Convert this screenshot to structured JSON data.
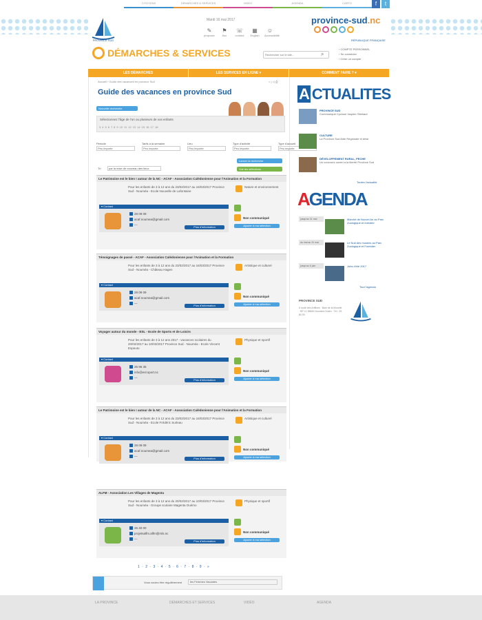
{
  "topnav": [
    "CITOYENS",
    "DEMARCHES & SERVICES",
    "VIDEO",
    "AGENDA",
    "CARTO"
  ],
  "social": {
    "facebook": "f",
    "twitter": "t"
  },
  "logo_label": "PROVINCE SUD",
  "header": {
    "date": "Mardi 16 mai 2017",
    "tools": [
      {
        "icon": "pencil-icon",
        "glyph": "✎",
        "label": "proposer"
      },
      {
        "icon": "bookmark-icon",
        "glyph": "⚑",
        "label": "flux"
      },
      {
        "icon": "contact-icon",
        "glyph": "☏",
        "label": "contact"
      },
      {
        "icon": "grid-icon",
        "glyph": "▦",
        "label": "English"
      },
      {
        "icon": "accessibility-icon",
        "glyph": "☺",
        "label": "Accessibilité"
      }
    ],
    "brand": "province-sud",
    "brand_suffix": ".nc",
    "brand_sub": "RÉPUBLIQUE FRANÇAISE"
  },
  "main_title": "DÉMARCHES & SERVICES",
  "search": {
    "placeholder": "Rechercher sur le site..."
  },
  "account": [
    "› COMPTE PERSONNEL",
    "› Se connecter",
    "› Créer un compte"
  ],
  "navbar": [
    "LES DÉMARCHES",
    "LES SERVICES EN LIGNE ▾",
    "COMMENT FAIRE ? ▾"
  ],
  "breadcrumb": "Accueil › Guide des vacances en province Sud",
  "pager_top": "< | >| ⎙",
  "page_title": "Guide des vacances en province Sud",
  "new_search": "Nouvelle recherche",
  "filter_intro": "Sélectionnez l'âge de l'un ou plusieurs de vos enfants",
  "ages": [
    "3",
    "4",
    "5",
    "6",
    "7",
    "8",
    "9",
    "10",
    "11",
    "12",
    "13",
    "14",
    "15",
    "16",
    "17",
    "18"
  ],
  "filters": [
    {
      "label": "Période",
      "value": "Peu importe"
    },
    {
      "label": "Tarifs à la semaine",
      "value": "Peu importe"
    },
    {
      "label": "Lieu",
      "value": "Peu importe"
    },
    {
      "label": "Type d'activité",
      "value": "Peu importe"
    },
    {
      "label": "Type d'accueil",
      "value": "Peu importe"
    }
  ],
  "sort": {
    "label": "Tri",
    "value": "par la mise de nouveau des lieux"
  },
  "btn_launch": "Lancer la recherche",
  "btn_all": "Voir les sélections",
  "cards": [
    {
      "title": "Le Patrimoine est le bien ! autour de la NC - ACAF - Association Calédonienne pour l'Animation et la Formation",
      "desc": "Pour les enfants de 3 à 12 ans du 23/02/2017 au 16/03/2017 Province Sud - Nouméa - Ecole Nouvelle de Lafontaine",
      "cat": "Nature et environnement",
      "phone": "28 09 09",
      "email": "acaf.noumea@gmail.com",
      "more": "Plus d'information",
      "label": "Non communiqué",
      "sel": "Ajouter à ma sélection"
    },
    {
      "title": "Témoignages de passé - ACAF - Association Calédonienne pour l'Animation et la Formation",
      "desc": "Pour les enfants de 3 à 12 ans du 23/02/2017 au 16/03/2017 Province Sud - Nouméa - Château Hagen",
      "cat": "Artistique et culturel",
      "phone": "28 09 09",
      "email": "acaf.noumea@gmail.com",
      "more": "Plus d'information",
      "label": "Non communiqué",
      "sel": "Ajouter à ma sélection"
    },
    {
      "title": "Voyager autour du monde - ESL - Ecole de Sports et de Loisirs",
      "desc": "Pour les enfants de 3 à 12 ans 2017 - vacances scolaires du 20/02/2017 au 10/03/2017 Province Sud - Nouméa - Ecole Vincent Espeuto",
      "cat": "Physique et sportif",
      "phone": "26 96 35",
      "email": "info@esl.sport.nc",
      "more": "Plus d'information",
      "label": "Non communiqué",
      "sel": "Ajouter à ma sélection"
    },
    {
      "title": "Le Patrimoine est le bien ! autour de la NC - ACAF - Association Calédonienne pour l'Animation et la Formation",
      "desc": "Pour les enfants de 3 à 12 ans du 23/02/2017 au 16/03/2017 Province Sud - Nouméa - Ecole Frédéric Surleau",
      "cat": "Artistique et culturel",
      "phone": "28 09 09",
      "email": "acaf.noumea@gmail.com",
      "more": "Plus d'information",
      "label": "Non communiqué",
      "sel": "Ajouter à ma sélection"
    },
    {
      "title": "ALFM - Association Les Villages de Magenta",
      "desc": "Pour les enfants de 3 à 12 ans du 20/02/2017 au 10/03/2017 Province Sud - Nouméa - Groupe scolaire Magenta Ouémo",
      "cat": "Physique et sportif",
      "phone": "26 40 00",
      "email": "projetsalfm.alfm@mls.nc",
      "more": "Plus d'information",
      "label": "Non communiqué",
      "sel": "Ajouter à ma sélection"
    }
  ],
  "pagination": "1 · 2 · 3 · 4 · 5 · 6 · 7 · 8 · 9 · »",
  "bottom": {
    "label": "Vous voulez être régulièrement",
    "value": "les Femmes Vacantes"
  },
  "news": {
    "title_a": "A",
    "title_b": "CTUALITES",
    "items": [
      {
        "head": "PROVINCE SUD",
        "text": "Communiqué Cyclone Inspirer Sitehaut"
      },
      {
        "head": "CULTURE",
        "text": "La Province Sud Aide Régionale et désir"
      },
      {
        "head": "DÉVELOPPEMENT RURAL, PECHE",
        "text": "Un concours ouvert a la liberté Province Sud"
      }
    ],
    "all": "Toutes l'actualité"
  },
  "agenda": {
    "title_a": "A",
    "title_b": "GENDA",
    "items": [
      {
        "date": "jusqu'au 31 mai",
        "text": "Marché de Nouvel An au Parc Zoologique et forestier"
      },
      {
        "date": "du mai au 31 mai",
        "text": "Le Nuit des musées au Parc Zoologique et Forestier"
      },
      {
        "date": "jusqu'au 6 juin",
        "text": "Jobs d'été 2017"
      }
    ],
    "all": "Tout l'agenda"
  },
  "ps_side": {
    "title": "PROVINCE SUD",
    "addr": "6 route des Artifices · Baie de la Moselle · BP L1 98849 Nouméa Cedex · Tél : 25 80 00"
  },
  "footer": [
    "LA PROVINCE",
    "DÉMARCHES ET SERVICES",
    "VIDÉO",
    "AGENDA"
  ]
}
